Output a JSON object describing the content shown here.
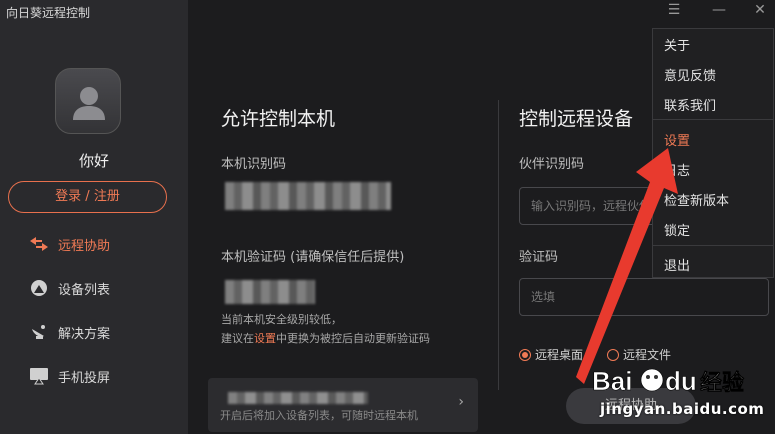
{
  "app": {
    "title": "向日葵远程控制"
  },
  "sidebar": {
    "greeting": "你好",
    "login_label": "登录 / 注册",
    "items": [
      {
        "label": "远程协助",
        "icon": "remote-assist-icon",
        "active": true
      },
      {
        "label": "设备列表",
        "icon": "device-list-icon",
        "active": false
      },
      {
        "label": "解决方案",
        "icon": "satellite-dish-icon",
        "active": false
      },
      {
        "label": "手机投屏",
        "icon": "screen-cast-icon",
        "active": false
      }
    ]
  },
  "allow_control": {
    "title": "允许控制本机",
    "id_label": "本机识别码",
    "code_label": "本机验证码 (请确保信任后提供)",
    "note_line1": "当前本机安全级别较低，",
    "note_line2_prefix": "建议在",
    "note_line2_link": "设置",
    "note_line2_suffix": "中更换为被控后自动更新验证码",
    "bottom_hint": "开启后将加入设备列表，可随时远程本机"
  },
  "remote_control": {
    "title": "控制远程设备",
    "partner_label": "伙伴识别码",
    "partner_placeholder": "输入识别码，远程伙伴",
    "code_label": "验证码",
    "code_placeholder": "选填",
    "radio_desktop": "远程桌面",
    "radio_file": "远程文件",
    "connect_label": "远程协助"
  },
  "menu": {
    "items": [
      "关于",
      "意见反馈",
      "联系我们",
      "设置",
      "日志",
      "检查新版本",
      "锁定",
      "退出"
    ],
    "active_index": 3
  },
  "watermark": {
    "brand": "Bai du 经验",
    "url": "jingyan.baidu.com"
  },
  "colors": {
    "accent": "#f07a55",
    "annotation": "#e83a2e",
    "sidebar_bg": "#2a2a2d",
    "main_bg": "#1c1c1e"
  }
}
